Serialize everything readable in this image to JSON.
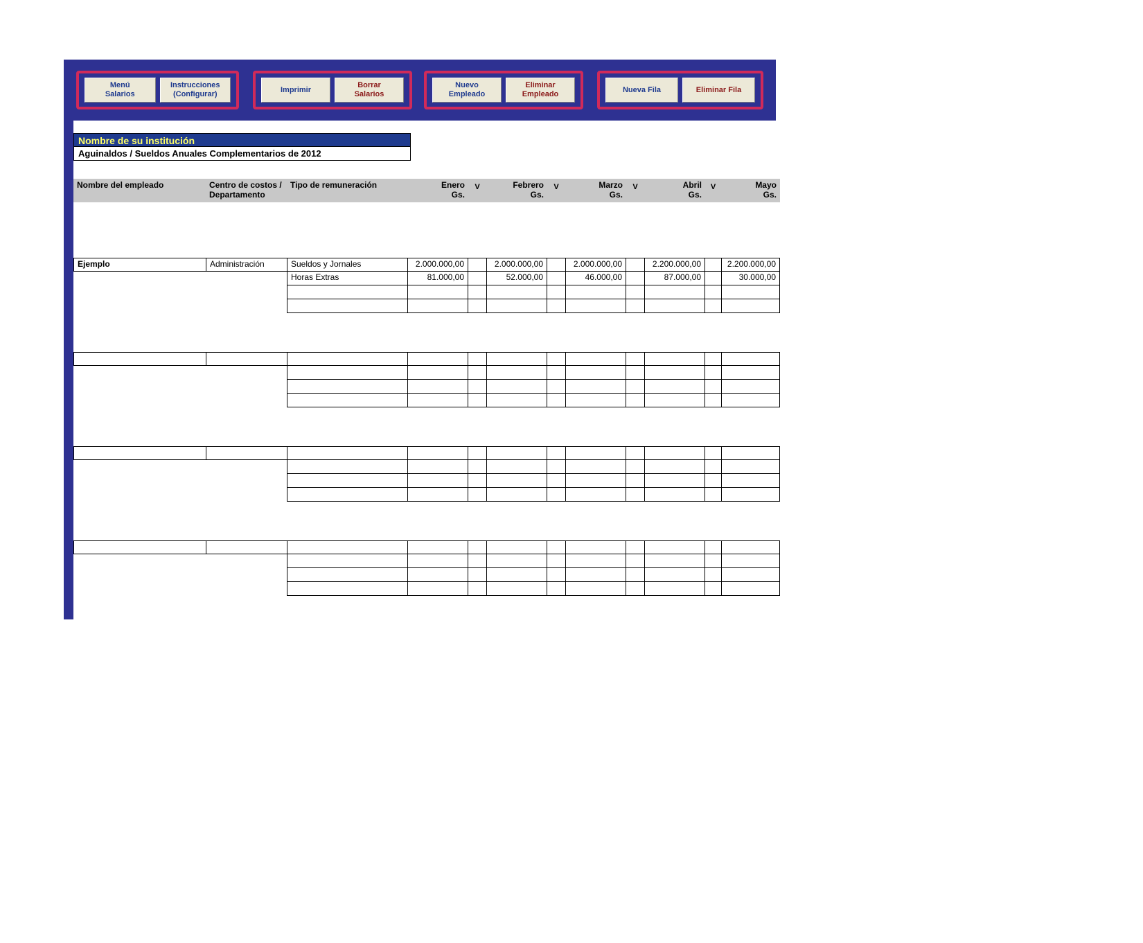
{
  "toolbar": {
    "menu_salarios": "Menú\nSalarios",
    "instrucciones": "Instrucciones\n(Configurar)",
    "imprimir": "Imprimir",
    "borrar_salarios": "Borrar\nSalarios",
    "nuevo_empleado": "Nuevo\nEmpleado",
    "eliminar_empleado": "Eliminar\nEmpleado",
    "nueva_fila": "Nueva Fila",
    "eliminar_fila": "Eliminar Fila"
  },
  "titles": {
    "institution": "Nombre de su institución",
    "subtitle": "Aguinaldos / Sueldos Anuales Complementarios de 2012"
  },
  "headers": {
    "employee": "Nombre del empleado",
    "centro": "Centro de costos / Departamento",
    "tipo": "Tipo de remuneración",
    "months": [
      "Enero",
      "Febrero",
      "Marzo",
      "Abril",
      "Mayo"
    ],
    "currency": "Gs.",
    "v": "V"
  },
  "blocks": [
    {
      "employee": "Ejemplo",
      "centro": "Administración",
      "rows": [
        {
          "tipo": "Sueldos y Jornales",
          "vals": [
            "2.000.000,00",
            "2.000.000,00",
            "2.000.000,00",
            "2.200.000,00",
            "2.200.000,00"
          ]
        },
        {
          "tipo": "Horas Extras",
          "vals": [
            "81.000,00",
            "52.000,00",
            "46.000,00",
            "87.000,00",
            "30.000,00"
          ]
        },
        {
          "tipo": "",
          "vals": [
            "",
            "",
            "",
            "",
            ""
          ]
        },
        {
          "tipo": "",
          "vals": [
            "",
            "",
            "",
            "",
            ""
          ]
        }
      ]
    },
    {
      "employee": "",
      "centro": "",
      "rows": [
        {
          "tipo": "",
          "vals": [
            "",
            "",
            "",
            "",
            ""
          ]
        },
        {
          "tipo": "",
          "vals": [
            "",
            "",
            "",
            "",
            ""
          ]
        },
        {
          "tipo": "",
          "vals": [
            "",
            "",
            "",
            "",
            ""
          ]
        },
        {
          "tipo": "",
          "vals": [
            "",
            "",
            "",
            "",
            ""
          ]
        }
      ]
    },
    {
      "employee": "",
      "centro": "",
      "rows": [
        {
          "tipo": "",
          "vals": [
            "",
            "",
            "",
            "",
            ""
          ]
        },
        {
          "tipo": "",
          "vals": [
            "",
            "",
            "",
            "",
            ""
          ]
        },
        {
          "tipo": "",
          "vals": [
            "",
            "",
            "",
            "",
            ""
          ]
        },
        {
          "tipo": "",
          "vals": [
            "",
            "",
            "",
            "",
            ""
          ]
        }
      ]
    },
    {
      "employee": "",
      "centro": "",
      "rows": [
        {
          "tipo": "",
          "vals": [
            "",
            "",
            "",
            "",
            ""
          ]
        },
        {
          "tipo": "",
          "vals": [
            "",
            "",
            "",
            "",
            ""
          ]
        },
        {
          "tipo": "",
          "vals": [
            "",
            "",
            "",
            "",
            ""
          ]
        },
        {
          "tipo": "",
          "vals": [
            "",
            "",
            "",
            "",
            ""
          ]
        }
      ]
    }
  ]
}
